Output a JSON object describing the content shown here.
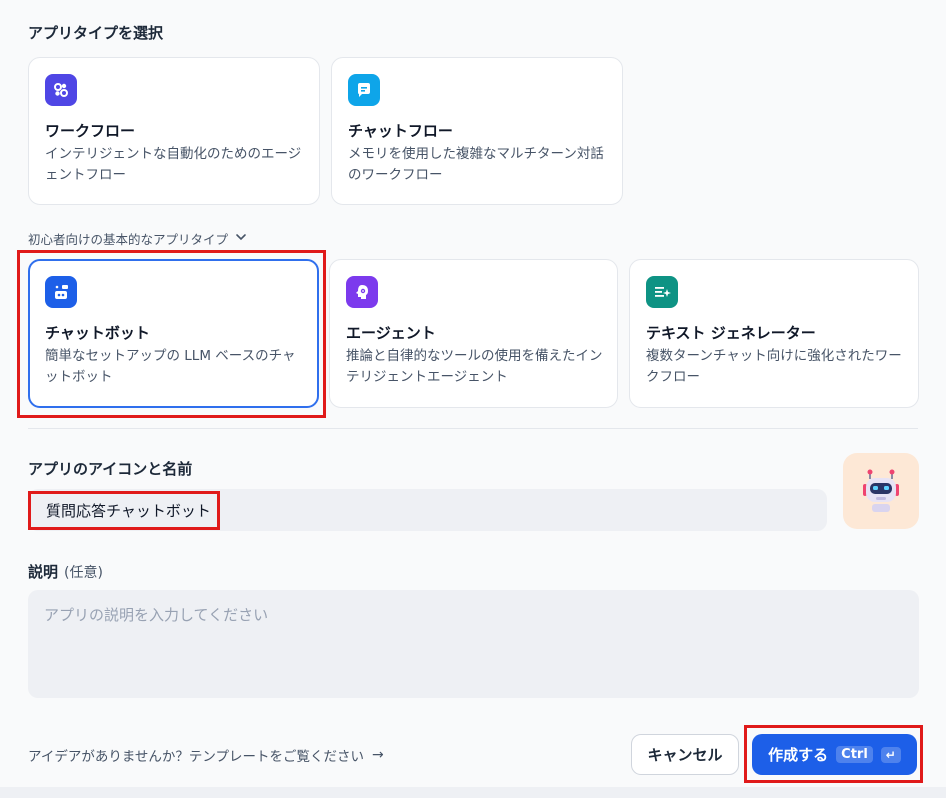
{
  "app_type_section": {
    "title": "アプリタイプを選択"
  },
  "top_cards": [
    {
      "title": "ワークフロー",
      "desc": "インテリジェントな自動化のためのエージェントフロー",
      "icon": "workflow-icon",
      "color": "#4f46e5"
    },
    {
      "title": "チャットフロー",
      "desc": "メモリを使用した複雑なマルチターン対話のワークフロー",
      "icon": "chatflow-icon",
      "color": "#0ea5e9"
    }
  ],
  "basic_toggle": {
    "label": "初心者向けの基本的なアプリタイプ",
    "icon": "chevron-down-icon"
  },
  "basic_cards": [
    {
      "title": "チャットボット",
      "desc": "簡単なセットアップの LLM ベースのチャットボット",
      "icon": "chatbot-icon",
      "color": "#1d5fe8",
      "selected": true
    },
    {
      "title": "エージェント",
      "desc": "推論と自律的なツールの使用を備えたインテリジェントエージェント",
      "icon": "agent-icon",
      "color": "#7c3aed"
    },
    {
      "title": "テキスト ジェネレーター",
      "desc": "複数ターンチャット向けに強化されたワークフロー",
      "icon": "text-generator-icon",
      "color": "#0e9384"
    }
  ],
  "name_section": {
    "title": "アプリのアイコンと名前",
    "value": "質問応答チャットボット",
    "avatar_icon": "robot-avatar-icon"
  },
  "description_section": {
    "title": "説明",
    "optional": "(任意)",
    "placeholder": "アプリの説明を入力してください"
  },
  "footer": {
    "template_link": "アイデアがありませんか？テンプレートをご覧ください",
    "template_arrow": "→",
    "cancel_label": "キャンセル",
    "create_label": "作成する",
    "shortcut_label": "Ctrl",
    "enter_glyph": "↵"
  },
  "colors": {
    "accent": "#1d5fe8",
    "highlight": "#e01a1a"
  }
}
